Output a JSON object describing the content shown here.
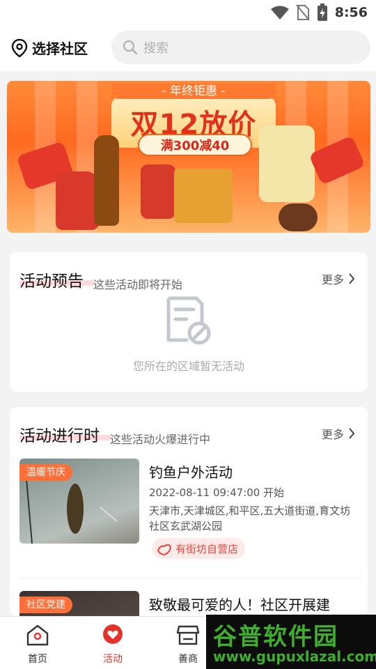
{
  "status": {
    "time": "8:56"
  },
  "header": {
    "location_label": "选择社区",
    "search_placeholder": "搜索"
  },
  "banner": {
    "pill": "- 年终钜惠 -",
    "title": "双12放价",
    "subtitle": "满300减40"
  },
  "preview_section": {
    "title": "活动预告",
    "subtitle": "这些活动即将开始",
    "more": "更多",
    "empty_text": "您所在的区域暂无活动"
  },
  "ongoing_section": {
    "title": "活动进行时",
    "subtitle": "这些活动火爆进行中",
    "more": "更多",
    "items": [
      {
        "tag": "温暖节庆",
        "title": "钓鱼户外活动",
        "time": "2022-08-11 09:47:00 开始",
        "address": "天津市,天津城区,和平区,五大道街道,育文坊社区玄武湖公园",
        "organizer": "有街坊自营店"
      },
      {
        "tag": "社区党建",
        "title": "致敬最可爱的人！社区开展建"
      }
    ]
  },
  "tabbar": {
    "tabs": [
      {
        "label": "首页",
        "active": false
      },
      {
        "label": "活动",
        "active": true
      },
      {
        "label": "善商",
        "active": false
      }
    ]
  },
  "watermark": {
    "title": "谷普软件园",
    "url": "www.gupuxlazal.com"
  },
  "colors": {
    "accent": "#e5322b",
    "tag": "#ff6f3a",
    "banner": "#ff6a1f",
    "watermark": "#3fae2e"
  }
}
